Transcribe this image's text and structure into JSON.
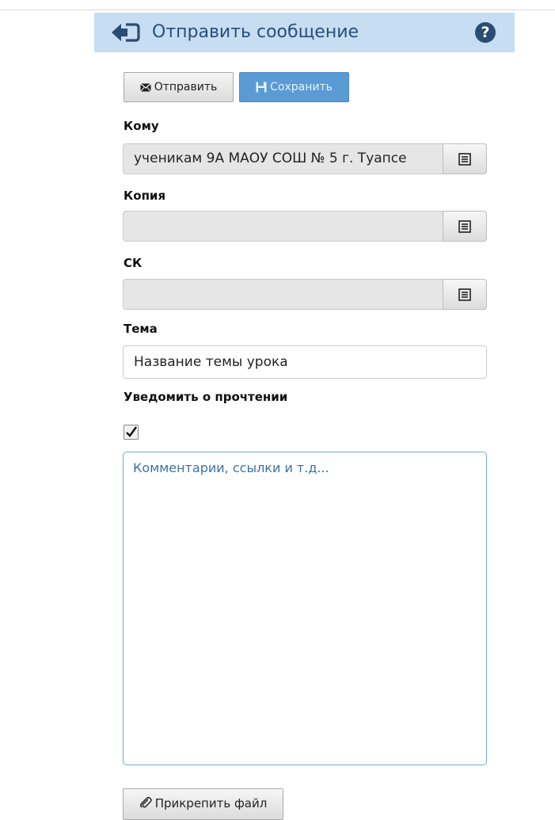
{
  "header": {
    "title": "Отправить сообщение",
    "back_icon": "arrow-back-icon",
    "help_label": "?",
    "background_color": "#c7ddf2"
  },
  "toolbar": {
    "send_label": "Отправить",
    "send_icon": "envelope-icon",
    "save_label": "Сохранить",
    "save_icon": "save-disk-icon",
    "save_color": "#5b9bd5"
  },
  "form": {
    "to": {
      "label": "Кому",
      "value": "ученикам 9А МАОУ СОШ № 5 г. Туапсе"
    },
    "cc": {
      "label": "Копия",
      "value": ""
    },
    "bcc": {
      "label": "СК",
      "value": ""
    },
    "subject": {
      "label": "Тема",
      "value": "Название темы урока"
    },
    "read_receipt": {
      "label": "Уведомить о прочтении",
      "checked": true
    },
    "comment": {
      "placeholder": "Комментарии, ссылки и т.д..."
    }
  },
  "attach": {
    "label": "Прикрепить файл",
    "icon": "paperclip-icon"
  }
}
